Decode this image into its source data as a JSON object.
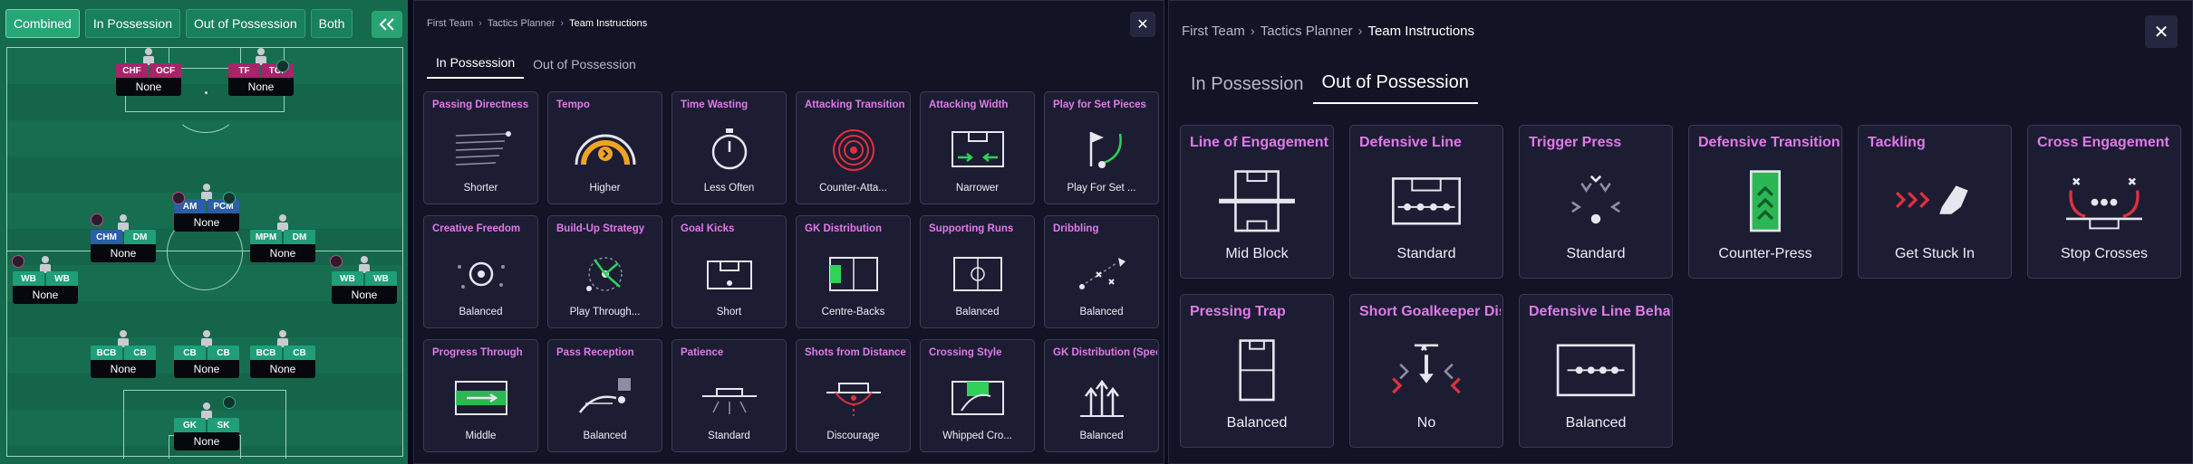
{
  "pitch": {
    "view_tabs": [
      "Combined",
      "In Possession",
      "Out of Possession",
      "Both"
    ],
    "active_tab": "Combined",
    "slots": [
      {
        "chips": [
          {
            "t": "CHF",
            "c": "pink"
          },
          {
            "t": "OCF",
            "c": "pink"
          }
        ],
        "name": "None"
      },
      {
        "chips": [
          {
            "t": "TF",
            "c": "pink"
          },
          {
            "t": "TCF",
            "c": "pink"
          }
        ],
        "name": "None"
      },
      {
        "chips": [
          {
            "t": "AM",
            "c": "blue"
          },
          {
            "t": "PCM",
            "c": "blue"
          }
        ],
        "name": "None"
      },
      {
        "chips": [
          {
            "t": "CHM",
            "c": "green"
          },
          {
            "t": "DM",
            "c": "green"
          }
        ],
        "name": "None"
      },
      {
        "chips": [
          {
            "t": "MPM",
            "c": "green"
          },
          {
            "t": "DM",
            "c": "green"
          }
        ],
        "name": "None"
      },
      {
        "chips": [
          {
            "t": "WB",
            "c": "green"
          },
          {
            "t": "WB",
            "c": "green"
          }
        ],
        "name": "None"
      },
      {
        "chips": [
          {
            "t": "WB",
            "c": "green"
          },
          {
            "t": "WB",
            "c": "green"
          }
        ],
        "name": "None"
      },
      {
        "chips": [
          {
            "t": "BCB",
            "c": "green"
          },
          {
            "t": "CB",
            "c": "green"
          }
        ],
        "name": "None"
      },
      {
        "chips": [
          {
            "t": "CB",
            "c": "green"
          },
          {
            "t": "CB",
            "c": "green"
          }
        ],
        "name": "None"
      },
      {
        "chips": [
          {
            "t": "BCB",
            "c": "green"
          },
          {
            "t": "CB",
            "c": "green"
          }
        ],
        "name": "None"
      },
      {
        "chips": [
          {
            "t": "GK",
            "c": "green"
          },
          {
            "t": "SK",
            "c": "green"
          }
        ],
        "name": "None"
      }
    ]
  },
  "mid": {
    "breadcrumbs": [
      "First Team",
      "Tactics Planner",
      "Team Instructions"
    ],
    "tabs": [
      "In Possession",
      "Out of Possession"
    ],
    "active_tab": "In Possession",
    "cards": [
      {
        "title": "Passing Directness",
        "value": "Shorter",
        "icon": "passing-directness-icon"
      },
      {
        "title": "Tempo",
        "value": "Higher",
        "icon": "tempo-gauge-icon"
      },
      {
        "title": "Time Wasting",
        "value": "Less Often",
        "icon": "stopwatch-icon"
      },
      {
        "title": "Attacking Transition",
        "value": "Counter-Atta...",
        "icon": "target-rings-icon"
      },
      {
        "title": "Attacking Width",
        "value": "Narrower",
        "icon": "attacking-width-icon"
      },
      {
        "title": "Play for Set Pieces",
        "value": "Play For Set ...",
        "icon": "corner-flag-icon"
      },
      {
        "title": "Creative Freedom",
        "value": "Balanced",
        "icon": "creative-ball-icon"
      },
      {
        "title": "Build-Up Strategy",
        "value": "Play Through...",
        "icon": "build-up-icon"
      },
      {
        "title": "Goal Kicks",
        "value": "Short",
        "icon": "goal-kicks-icon"
      },
      {
        "title": "GK Distribution",
        "value": "Centre-Backs",
        "icon": "gk-distribution-icon"
      },
      {
        "title": "Supporting Runs",
        "value": "Balanced",
        "icon": "supporting-runs-icon"
      },
      {
        "title": "Dribbling",
        "value": "Balanced",
        "icon": "dribbling-icon"
      },
      {
        "title": "Progress Through",
        "value": "Middle",
        "icon": "progress-through-icon"
      },
      {
        "title": "Pass Reception",
        "value": "Balanced",
        "icon": "pass-reception-icon"
      },
      {
        "title": "Patience",
        "value": "Standard",
        "icon": "patience-icon"
      },
      {
        "title": "Shots from Distance",
        "value": "Discourage",
        "icon": "shots-distance-icon"
      },
      {
        "title": "Crossing Style",
        "value": "Whipped Cro...",
        "icon": "crossing-style-icon"
      },
      {
        "title": "GK Distribution (Speed",
        "value": "Balanced",
        "icon": "gk-speed-icon"
      }
    ]
  },
  "right": {
    "breadcrumbs": [
      "First Team",
      "Tactics Planner",
      "Team Instructions"
    ],
    "tabs": [
      "In Possession",
      "Out of Possession"
    ],
    "active_tab": "Out of Possession",
    "cards": [
      {
        "title": "Line of Engagement",
        "value": "Mid Block",
        "icon": "line-of-engagement-icon"
      },
      {
        "title": "Defensive Line",
        "value": "Standard",
        "icon": "defensive-line-icon"
      },
      {
        "title": "Trigger Press",
        "value": "Standard",
        "icon": "trigger-press-icon"
      },
      {
        "title": "Defensive Transition",
        "value": "Counter-Press",
        "icon": "defensive-transition-icon"
      },
      {
        "title": "Tackling",
        "value": "Get Stuck In",
        "icon": "tackling-boot-icon"
      },
      {
        "title": "Cross Engagement",
        "value": "Stop Crosses",
        "icon": "cross-engagement-icon"
      },
      {
        "title": "Pressing Trap",
        "value": "Balanced",
        "icon": "pressing-trap-icon"
      },
      {
        "title": "Short Goalkeeper Distr",
        "value": "No",
        "icon": "short-gk-distribution-icon"
      },
      {
        "title": "Defensive Line Behavic",
        "value": "Balanced",
        "icon": "defensive-line-behaviour-icon"
      }
    ]
  },
  "colors": {
    "pitch": "#156a4d",
    "title_accent": "#e07ae8",
    "panel": "#121324",
    "card": "#1c1d33",
    "highlight_green": "#2fd15b",
    "highlight_red": "#e0313d"
  }
}
